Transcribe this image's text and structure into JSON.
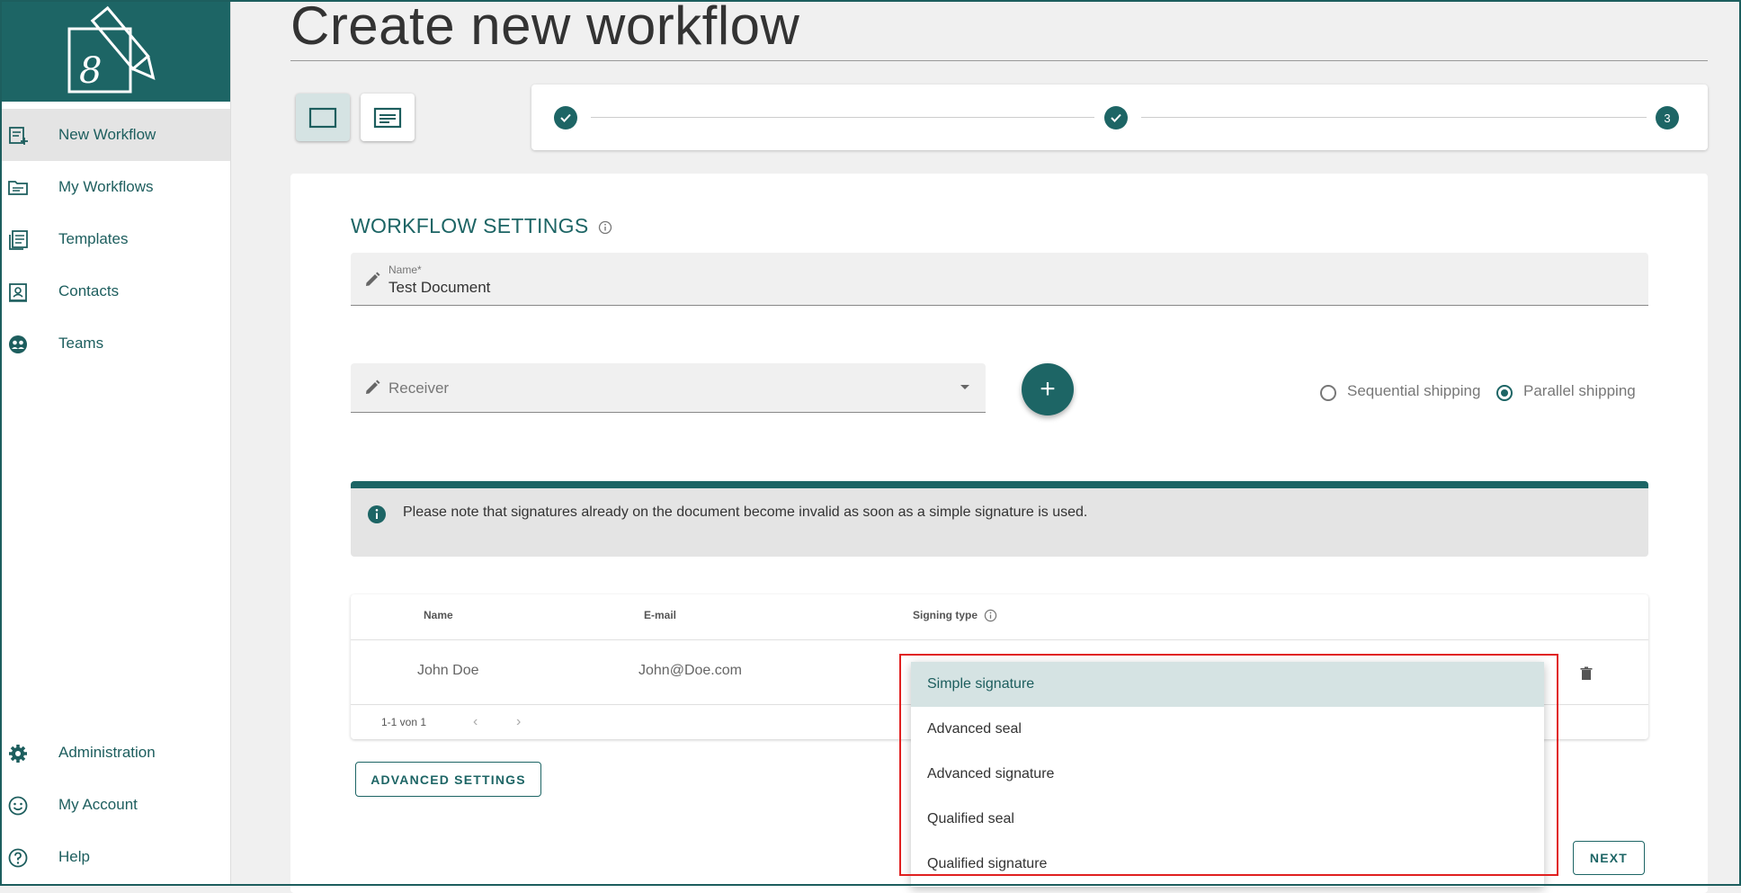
{
  "sidebar": {
    "items": [
      {
        "label": "New Workflow",
        "icon": "new-document-icon",
        "active": true
      },
      {
        "label": "My Workflows",
        "icon": "folder-icon"
      },
      {
        "label": "Templates",
        "icon": "templates-icon"
      },
      {
        "label": "Contacts",
        "icon": "contact-card-icon"
      },
      {
        "label": "Teams",
        "icon": "team-icon"
      }
    ],
    "bottom_items": [
      {
        "label": "Administration",
        "icon": "gear-icon"
      },
      {
        "label": "My Account",
        "icon": "smiley-icon"
      },
      {
        "label": "Help",
        "icon": "help-icon"
      }
    ]
  },
  "page": {
    "title": "Create new workflow"
  },
  "stepper": {
    "step3_label": "3"
  },
  "settings": {
    "title": "WORKFLOW SETTINGS",
    "name_label": "Name*",
    "name_value": "Test Document",
    "receiver_placeholder": "Receiver",
    "sequential_label": "Sequential shipping",
    "parallel_label": "Parallel shipping",
    "selected_shipping": "parallel",
    "notice": "Please note that signatures already on the document become invalid as soon as a simple signature is used."
  },
  "table": {
    "headers": {
      "name": "Name",
      "email": "E-mail",
      "signing_type": "Signing type"
    },
    "rows": [
      {
        "name": "John Doe",
        "email": "John@Doe.com"
      }
    ],
    "pager": "1-1 von 1"
  },
  "buttons": {
    "advanced_settings": "ADVANCED SETTINGS",
    "next": "NEXT"
  },
  "dropdown": {
    "options": [
      "Simple signature",
      "Advanced seal",
      "Advanced signature",
      "Qualified seal",
      "Qualified signature"
    ],
    "selected": "Simple signature"
  },
  "colors": {
    "brand": "#1d6565",
    "highlight": "#e02020"
  }
}
